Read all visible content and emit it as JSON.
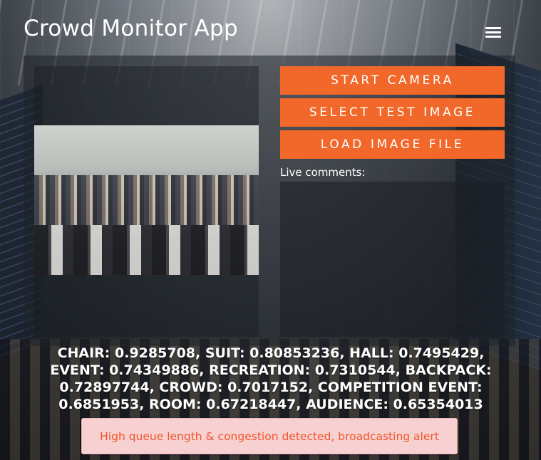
{
  "app": {
    "title": "Crowd Monitor App"
  },
  "controls": {
    "start_camera": "START CAMERA",
    "select_test_image": "SELECT TEST IMAGE",
    "load_image_file": "LOAD IMAGE FILE"
  },
  "comments": {
    "label": "Live comments:",
    "text": ""
  },
  "results": {
    "tags_text": "CHAIR: 0.9285708, SUIT: 0.80853236, HALL: 0.7495429, EVENT: 0.74349886, RECREATION: 0.7310544, BACKPACK: 0.72897744, CROWD: 0.7017152, COMPETITION EVENT: 0.6851953, ROOM: 0.67218447, AUDIENCE: 0.65354013"
  },
  "alert": {
    "message": "High queue length & congestion detected, broadcasting alert"
  },
  "colors": {
    "accent": "#f2682a",
    "alert_bg": "#f7d1d1",
    "alert_text": "#f0552a"
  },
  "icons": {
    "menu": "hamburger-menu-icon"
  }
}
